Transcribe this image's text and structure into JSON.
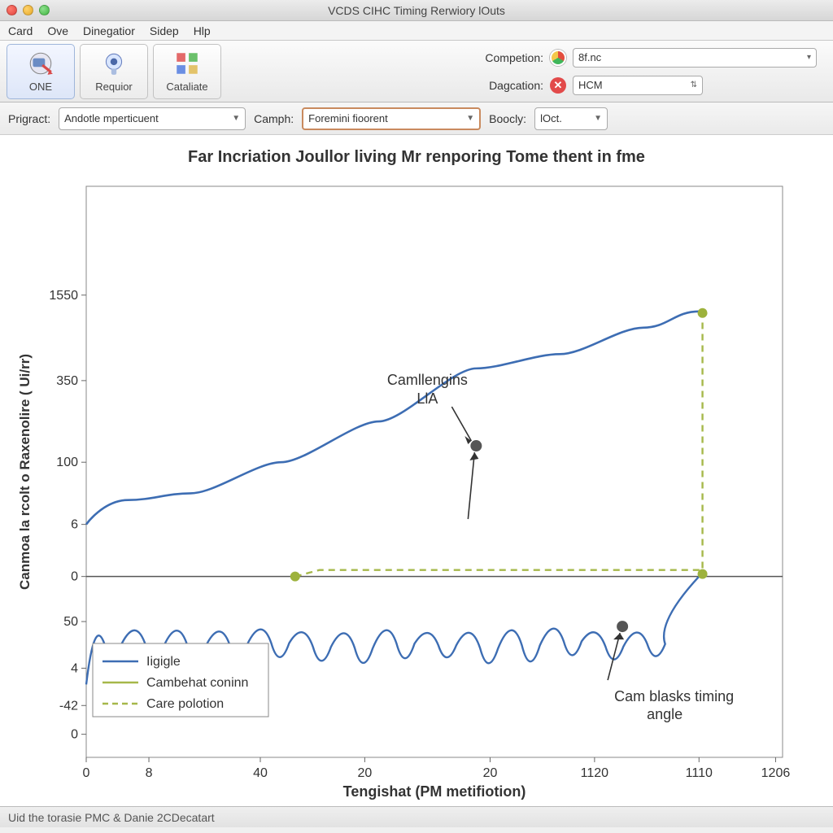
{
  "window": {
    "title": "VCDS CIHC Timing Rerwiory lOuts"
  },
  "menu": {
    "items": [
      "Card",
      "Ove",
      "Dinegatior",
      "Sidep",
      "Hlp"
    ]
  },
  "toolbar": {
    "buttons": [
      {
        "label": "ONE",
        "icon": "inspect-icon"
      },
      {
        "label": "Requior",
        "icon": "target-icon"
      },
      {
        "label": "Cataliate",
        "icon": "grid-icon"
      }
    ],
    "competion_label": "Competion:",
    "competion_value": "8f.nc",
    "dagcation_label": "Dagcation:",
    "dagcation_value": "HCM"
  },
  "filters": {
    "prigract_label": "Prigract:",
    "prigract_value": "Andotle mperticuent",
    "camph_label": "Camph:",
    "camph_value": "Foremini fioorent",
    "boocly_label": "Boocly:",
    "boocly_value": "lOct."
  },
  "chart_title": "Far Incriation Joullor living Mr renporing Tome thent in fme",
  "chart_data": {
    "type": "line",
    "title": "Far Incriation Joullor living Mr renporing Tome thent in fme",
    "xlabel": "Tengishat  (PM metifiotion)",
    "ylabel": "Canmoa la rcolt o Raxenolire  ( Ui/rr)",
    "y_ticks": [
      0,
      -42,
      4,
      50,
      0,
      6,
      100,
      350,
      1550
    ],
    "x_ticks": [
      0,
      8,
      40,
      20,
      20,
      1120,
      1110,
      1206
    ],
    "legend": [
      "Iigigle",
      "Cambehat coninn",
      "Care polotion"
    ],
    "annotations": [
      {
        "text": "Camllengins LlA",
        "x": 20,
        "y": 350
      },
      {
        "text": "Cam blasks timing angle",
        "x": 1120,
        "y": 50
      }
    ],
    "series": [
      {
        "name": "Iigigle (smooth)",
        "x": [
          0,
          8,
          40,
          20,
          20,
          1120,
          1110
        ],
        "y": [
          6,
          30,
          80,
          120,
          350,
          1200,
          1500
        ]
      },
      {
        "name": "Iigigle (oscillating)",
        "x": [
          0,
          8,
          40,
          20,
          20,
          1120,
          1110
        ],
        "y": [
          4,
          50,
          4,
          50,
          4,
          50,
          0
        ]
      },
      {
        "name": "Cambehat coninn",
        "x": [
          40,
          1110,
          1110
        ],
        "y": [
          0,
          0,
          1500
        ]
      },
      {
        "name": "Care polotion",
        "x": [
          40,
          1110
        ],
        "y": [
          0,
          0
        ]
      }
    ]
  },
  "statusbar": {
    "text": "Uid the torasie PMC & Danie 2CDecatart"
  }
}
